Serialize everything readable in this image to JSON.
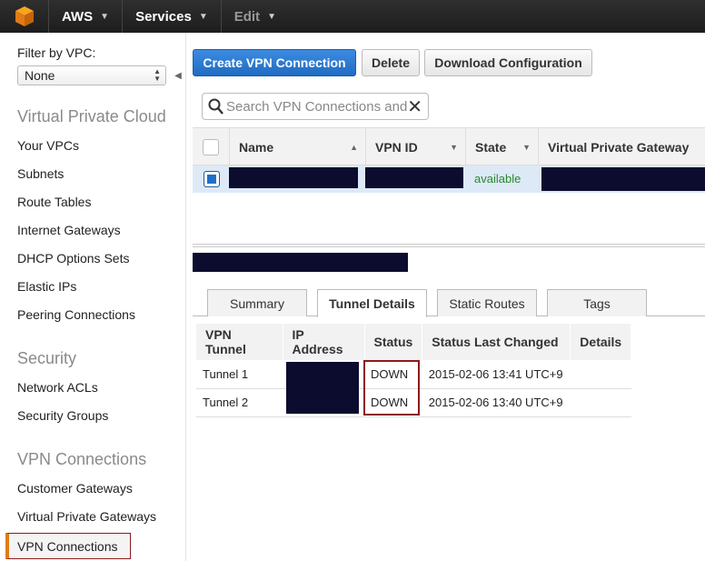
{
  "topbar": {
    "logo_icon": "aws-cube-icon",
    "aws_label": "AWS",
    "services_label": "Services",
    "edit_label": "Edit"
  },
  "sidebar": {
    "filter_label": "Filter by VPC:",
    "filter_value": "None",
    "sections": [
      {
        "title": "Virtual Private Cloud",
        "items": [
          "Your VPCs",
          "Subnets",
          "Route Tables",
          "Internet Gateways",
          "DHCP Options Sets",
          "Elastic IPs",
          "Peering Connections"
        ]
      },
      {
        "title": "Security",
        "items": [
          "Network ACLs",
          "Security Groups"
        ]
      },
      {
        "title": "VPN Connections",
        "items": [
          "Customer Gateways",
          "Virtual Private Gateways",
          "VPN Connections"
        ]
      }
    ],
    "active_item": "VPN Connections",
    "active_accent": "#e07b17"
  },
  "toolbar": {
    "create_label": "Create VPN Connection",
    "delete_label": "Delete",
    "download_label": "Download Configuration"
  },
  "search": {
    "placeholder": "Search VPN Connections and their properties"
  },
  "grid": {
    "columns": [
      "Name",
      "VPN ID",
      "State",
      "Virtual Private Gateway"
    ],
    "rows": [
      {
        "state": "available"
      }
    ]
  },
  "details": {
    "tabs": [
      "Summary",
      "Tunnel Details",
      "Static Routes",
      "Tags"
    ],
    "active_tab": "Tunnel Details",
    "table": {
      "headers": [
        "VPN Tunnel",
        "IP Address",
        "Status",
        "Status Last Changed",
        "Details"
      ],
      "rows": [
        {
          "tunnel": "Tunnel 1",
          "status": "DOWN",
          "changed": "2015-02-06 13:41 UTC+9",
          "details": ""
        },
        {
          "tunnel": "Tunnel 2",
          "status": "DOWN",
          "changed": "2015-02-06 13:40 UTC+9",
          "details": ""
        }
      ]
    }
  },
  "colors": {
    "primary_button": "#1f6cc2",
    "state_available": "#2a8a2a",
    "highlight_border": "#8b1a1a"
  }
}
